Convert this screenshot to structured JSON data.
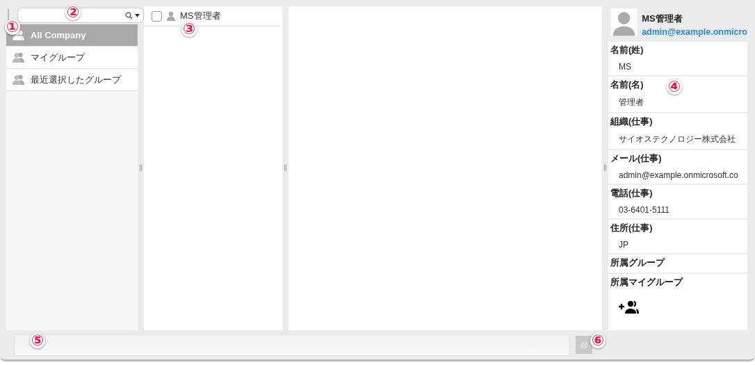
{
  "groups": {
    "items": [
      {
        "label": "All Company",
        "selected": true
      },
      {
        "label": "マイグループ",
        "selected": false
      },
      {
        "label": "最近選択したグループ",
        "selected": false
      }
    ]
  },
  "members": [
    {
      "name": "MS管理者",
      "checked": false
    }
  ],
  "details": {
    "name": "MS管理者",
    "email": "admin@example.onmicro",
    "fields": [
      {
        "label": "名前(姓)",
        "value": "MS",
        "kind": "text"
      },
      {
        "label": "名前(名)",
        "value": "管理者",
        "kind": "text"
      },
      {
        "label": "組織(仕事)",
        "value": "サイオステクノロジー株式会社",
        "kind": "text"
      },
      {
        "label": "メール(仕事)",
        "value": "admin@example.onmicrosoft.co",
        "kind": "text"
      },
      {
        "label": "電話(仕事)",
        "value": "03-6401-5111",
        "kind": "text"
      },
      {
        "label": "住所(仕事)",
        "value": "JP",
        "kind": "text"
      },
      {
        "label": "所属グループ",
        "kind": "empty"
      },
      {
        "label": "所属マイグループ",
        "kind": "add"
      }
    ]
  },
  "bottom": {
    "button": "@"
  },
  "callouts": [
    "①",
    "②",
    "③",
    "④",
    "⑤",
    "⑥"
  ]
}
